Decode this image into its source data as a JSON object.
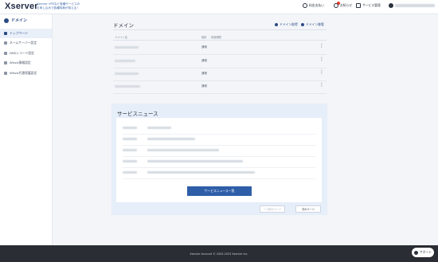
{
  "header": {
    "logo": "Xserver",
    "promo_line1": "Xserver VPSなど各種サービスの",
    "promo_line2": "お申し込みで各種特典が貰える！",
    "nav": [
      {
        "label": "料金支払い",
        "icon": "payment-icon"
      },
      {
        "label": "お知らせ",
        "icon": "bell-icon"
      },
      {
        "label": "サービス管理",
        "icon": "grid-icon"
      }
    ],
    "user_icon": "user-icon"
  },
  "sidebar": {
    "title": "ドメイン",
    "items": [
      {
        "label": "トップページ",
        "active": true
      },
      {
        "label": "ネームサーバー設定",
        "active": false
      },
      {
        "label": "DNSレコード設定",
        "active": false
      },
      {
        "label": "Whois情報設定",
        "active": false
      },
      {
        "label": "Whois代理保護設定",
        "active": false
      }
    ]
  },
  "domains": {
    "title": "ドメイン",
    "action_acquire": "ドメイン取得",
    "action_transfer": "ドメイン移管",
    "columns": {
      "name": "ドメイン名",
      "status": "契約",
      "expiry": "利用期限"
    },
    "rows": [
      {
        "status": "通常"
      },
      {
        "status": "通常"
      },
      {
        "status": "通常"
      },
      {
        "status": "通常"
      }
    ]
  },
  "news": {
    "title": "サービスニュース",
    "list_button": "サービスニュース一覧",
    "prev_label": "一つ前のページ",
    "next_label": "次のページ"
  },
  "footer": {
    "copyright": "Xserver Account © 2003-2023 Xserver Inc."
  },
  "support": {
    "label": "サポート"
  }
}
